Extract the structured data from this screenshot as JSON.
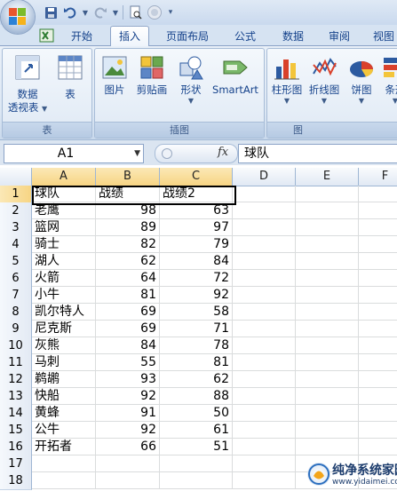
{
  "ribbon_tabs": [
    "开始",
    "插入",
    "页面布局",
    "公式",
    "数据",
    "审阅",
    "视图"
  ],
  "active_tab": "插入",
  "ribbon": {
    "groups": {
      "tables": {
        "label": "表",
        "pivot_label_line1": "数据",
        "pivot_label_line2": "透视表",
        "table_label": "表"
      },
      "illustrations": {
        "label": "插图",
        "picture": "图片",
        "clipart": "剪贴画",
        "shapes": "形状",
        "smartart": "SmartArt"
      },
      "charts": {
        "label": "图",
        "column": "柱形图",
        "line": "折线图",
        "pie": "饼图",
        "bar": "条形"
      }
    }
  },
  "formula_bar": {
    "name_box": "A1",
    "fx_label": "fx",
    "content": "球队"
  },
  "sheet": {
    "columns": [
      "A",
      "B",
      "C",
      "D",
      "E",
      "F"
    ],
    "rows": [
      [
        "球队",
        "战绩",
        "战绩2"
      ],
      [
        "老鹰",
        "98",
        "63"
      ],
      [
        "篮网",
        "89",
        "97"
      ],
      [
        "骑士",
        "82",
        "79"
      ],
      [
        "湖人",
        "62",
        "84"
      ],
      [
        "火箭",
        "64",
        "72"
      ],
      [
        "小牛",
        "81",
        "92"
      ],
      [
        "凯尔特人",
        "69",
        "58"
      ],
      [
        "尼克斯",
        "69",
        "71"
      ],
      [
        "灰熊",
        "84",
        "78"
      ],
      [
        "马刺",
        "55",
        "81"
      ],
      [
        "鹈鹕",
        "93",
        "62"
      ],
      [
        "快船",
        "92",
        "88"
      ],
      [
        "黄蜂",
        "91",
        "50"
      ],
      [
        "公牛",
        "92",
        "61"
      ],
      [
        "开拓者",
        "66",
        "51"
      ],
      [
        "",
        "",
        ""
      ],
      [
        "",
        "",
        ""
      ]
    ],
    "row_numbers": [
      "1",
      "2",
      "3",
      "4",
      "5",
      "6",
      "7",
      "8",
      "9",
      "10",
      "11",
      "12",
      "13",
      "14",
      "15",
      "16",
      "17",
      "18"
    ]
  },
  "watermark": {
    "title": "纯净系统家园",
    "url": "www.yidaimei.com"
  }
}
